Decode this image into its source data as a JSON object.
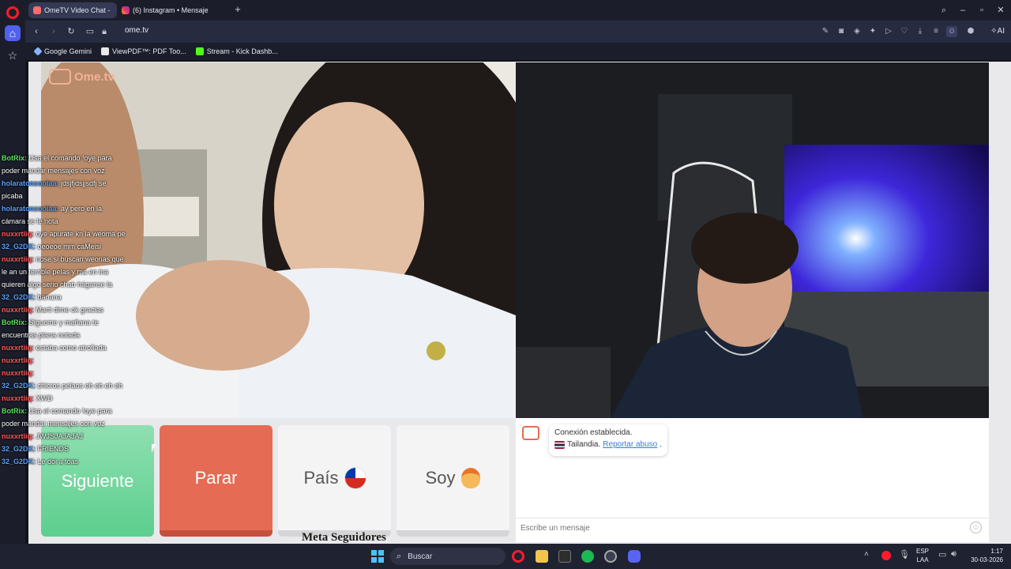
{
  "browser": {
    "tabs": [
      {
        "label": "OmeTV Video Chat -"
      },
      {
        "label": "(6) Instagram • Mensajes"
      }
    ],
    "url": "ome.tv",
    "ai_label": "AI",
    "bookmarks": [
      {
        "label": "Google Gemini"
      },
      {
        "label": "ViewPDF™: PDF Too..."
      },
      {
        "label": "Stream - Kick Dashb..."
      }
    ]
  },
  "ometv": {
    "logo": "Ome.tv",
    "buttons": {
      "next": "Siguiente",
      "stop": "Parar",
      "country": "País",
      "gender": "Soy"
    },
    "connection": {
      "status": "Conexión establecida.",
      "country": "Tailandia.",
      "report": "Reportar abuso"
    },
    "message_placeholder": "Escribe un mensaje"
  },
  "overlay": {
    "meta": "Meta Seguidores",
    "chat": [
      {
        "user": "BotRix:",
        "text": "Usa el comando !oye para poder mandar mensajes con voz"
      },
      {
        "user": "holaratoncoolaa:",
        "text": "jdsjfjdsjjsdfj se picaba"
      },
      {
        "user": "holaratoncoolaa:",
        "text": "ay pero en la cámara se le nota"
      },
      {
        "user": "nuxxrtiiq:",
        "text": "oye apurate kn la weoma pe"
      },
      {
        "user": "32_G2DK:",
        "text": "oeoeoe mm caMeisi"
      },
      {
        "user": "nuxxrtiiq:",
        "text": "nose si buscan weonas que le an un terrible pelas y ma en ina quieren algo serio chab háganse la"
      },
      {
        "user": "32_G2DK:",
        "text": "banana"
      },
      {
        "user": "nuxxrtiiq:",
        "text": "Marti dime ok gracias"
      },
      {
        "user": "BotRix:",
        "text": "Sígueme y mañana te encuentras plana notada"
      },
      {
        "user": "nuxxrtiiq:",
        "text": "estaba como atrofiada"
      },
      {
        "user": "nuxxrtiiq:",
        "text": ""
      },
      {
        "user": "nuxxrtiiq:",
        "text": ""
      },
      {
        "user": "32_G2DK:",
        "text": "chicros pelaos eh eh eh eh"
      },
      {
        "user": "nuxxrtiiq:",
        "text": "XWD"
      },
      {
        "user": "BotRix:",
        "text": "Usa el comando !oye para poder mandar mensajes con voz"
      },
      {
        "user": "nuxxrtiiq:",
        "text": "JWJSJAJAJAJ"
      },
      {
        "user": "32_G2DK:",
        "text": "FRIENDS"
      },
      {
        "user": "32_G2DK:",
        "text": "Le doi a toas"
      }
    ]
  },
  "taskbar": {
    "search": "Buscar",
    "lang_top": "ESP",
    "lang_bottom": "LAA",
    "time": "1:17",
    "date": "30-03-2026"
  },
  "colors": {
    "accent": "#5061f0",
    "next": "#5ccf8e",
    "stop": "#e56b55",
    "link": "#3a7bd5"
  }
}
